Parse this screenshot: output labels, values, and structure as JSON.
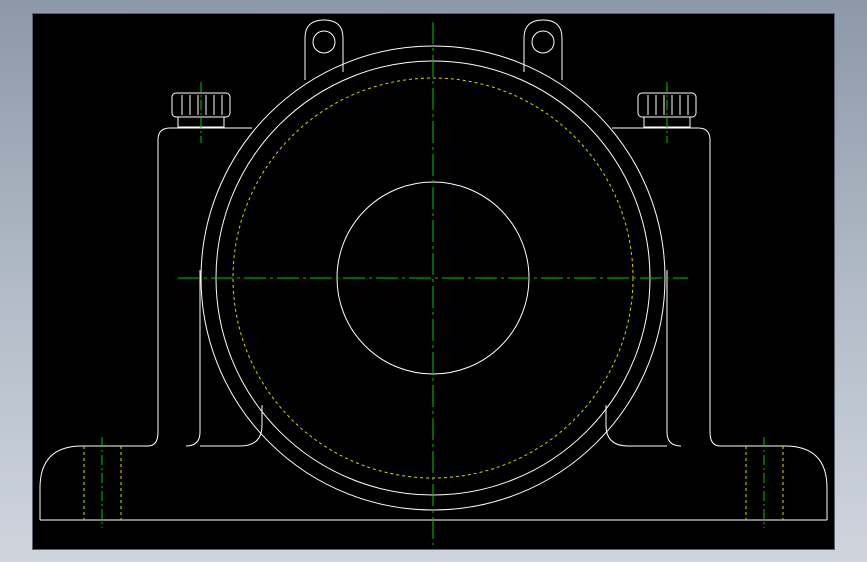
{
  "drawing": {
    "subject": "",
    "colors": {
      "background": "#000000",
      "edge": "#ffffff",
      "centerline": "#00c800",
      "hidden": "#d6d600",
      "frame_bg": "#9aa4b2"
    },
    "icons": [
      "plummer-block-outline",
      "bolt-hole",
      "lubrication-nipple",
      "lifting-eye"
    ]
  }
}
